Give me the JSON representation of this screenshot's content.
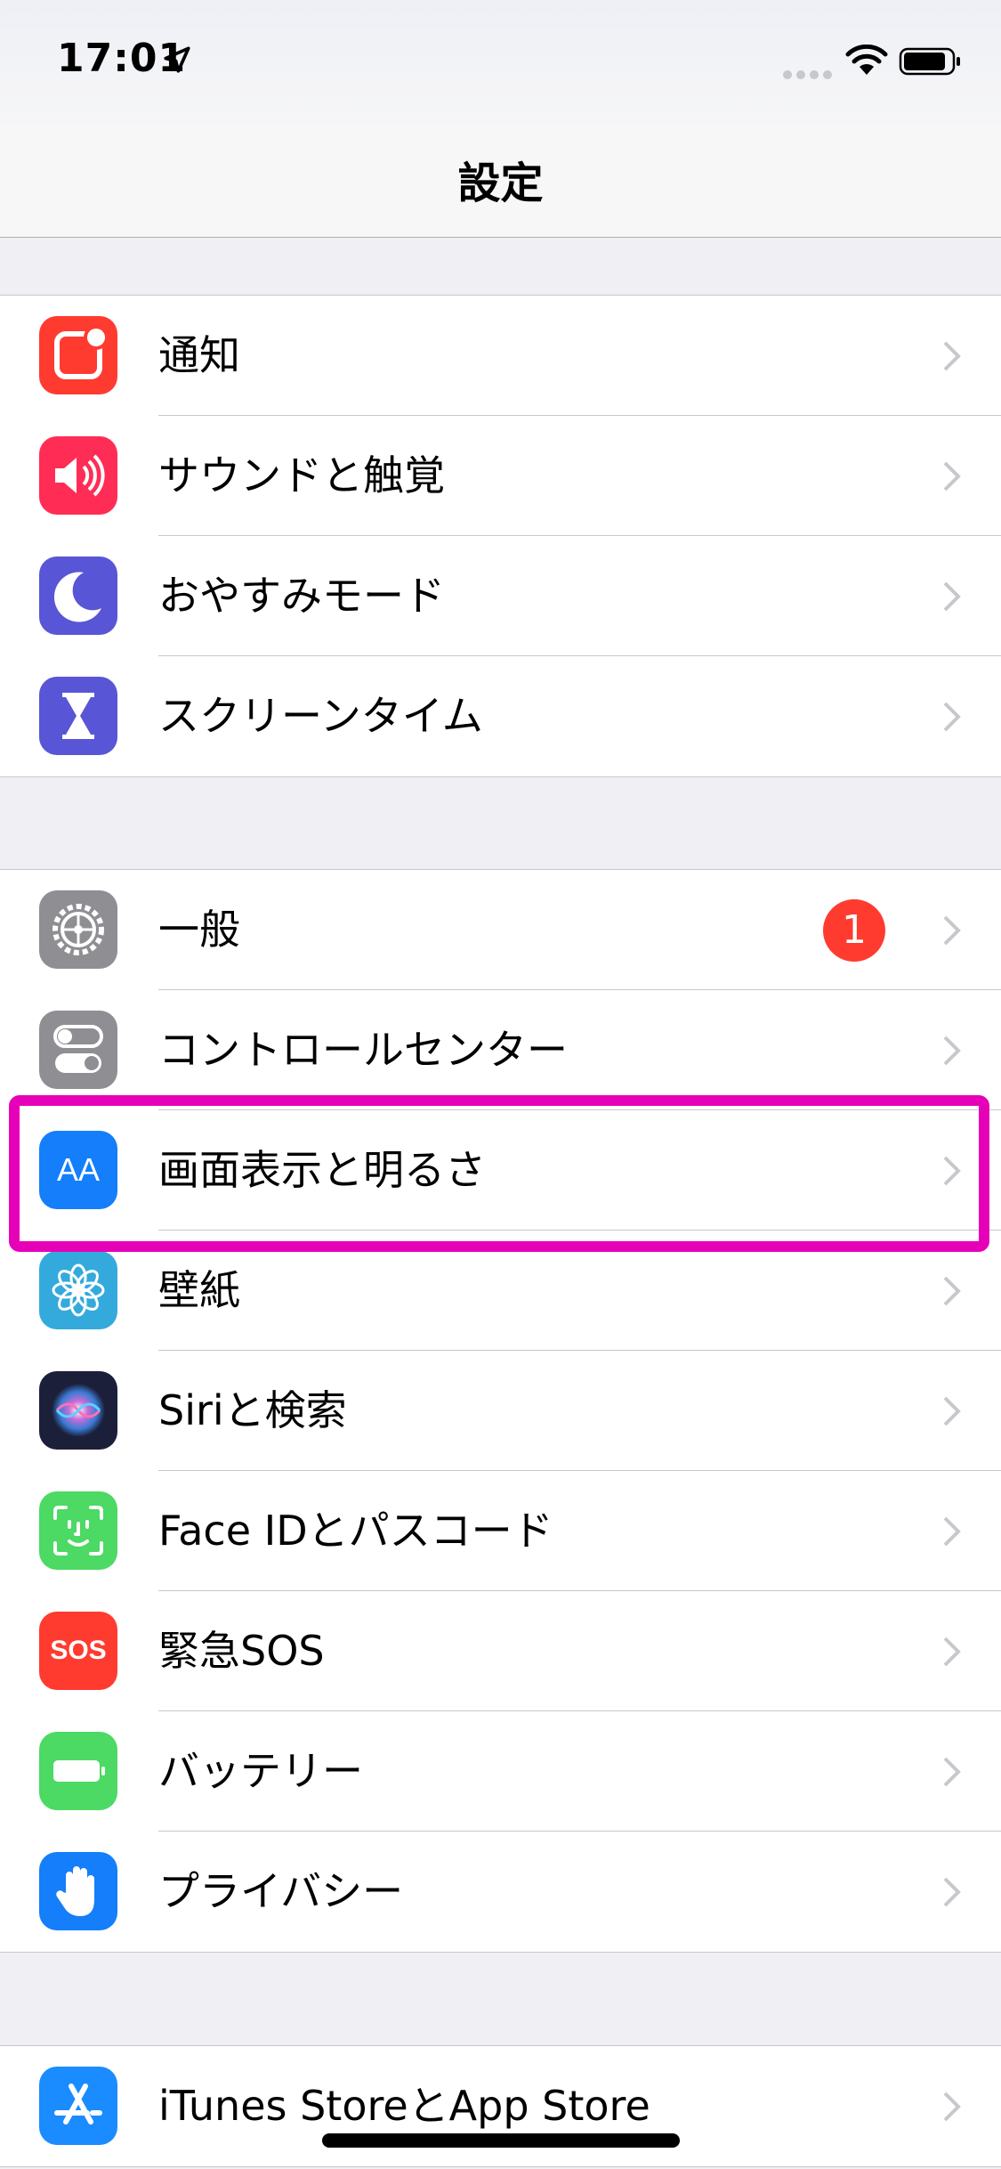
{
  "status_bar": {
    "time": "17:01"
  },
  "nav": {
    "title": "設定"
  },
  "groups": [
    [
      {
        "label": "通知",
        "icon": "notifications-icon",
        "color": "#ff3b30"
      },
      {
        "label": "サウンドと触覚",
        "icon": "sounds-icon",
        "color": "#ff2d55"
      },
      {
        "label": "おやすみモード",
        "icon": "moon-icon",
        "color": "#5856d6"
      },
      {
        "label": "スクリーンタイム",
        "icon": "hourglass-icon",
        "color": "#5856d6"
      }
    ],
    [
      {
        "label": "一般",
        "icon": "gear-icon",
        "color": "#8e8e93",
        "badge": "1"
      },
      {
        "label": "コントロールセンター",
        "icon": "toggles-icon",
        "color": "#8e8e93"
      },
      {
        "label": "画面表示と明るさ",
        "icon": "display-aa-icon",
        "color": "#147efb",
        "icon_text": "AA"
      },
      {
        "label": "壁紙",
        "icon": "wallpaper-flower-icon",
        "color": "#34aadc"
      },
      {
        "label": "Siriと検索",
        "icon": "siri-icon",
        "color": "#1b1f3a"
      },
      {
        "label": "Face IDとパスコード",
        "icon": "face-id-icon",
        "color": "#4cd964"
      },
      {
        "label": "緊急SOS",
        "icon": "sos-icon",
        "color": "#ff3b30",
        "icon_text": "SOS"
      },
      {
        "label": "バッテリー",
        "icon": "battery-icon",
        "color": "#4cd964"
      },
      {
        "label": "プライバシー",
        "icon": "hand-icon",
        "color": "#147efb"
      }
    ],
    [
      {
        "label": "iTunes StoreとApp Store",
        "icon": "app-store-icon",
        "color": "#1a8cff"
      }
    ]
  ],
  "highlight_color": "#e600b8"
}
